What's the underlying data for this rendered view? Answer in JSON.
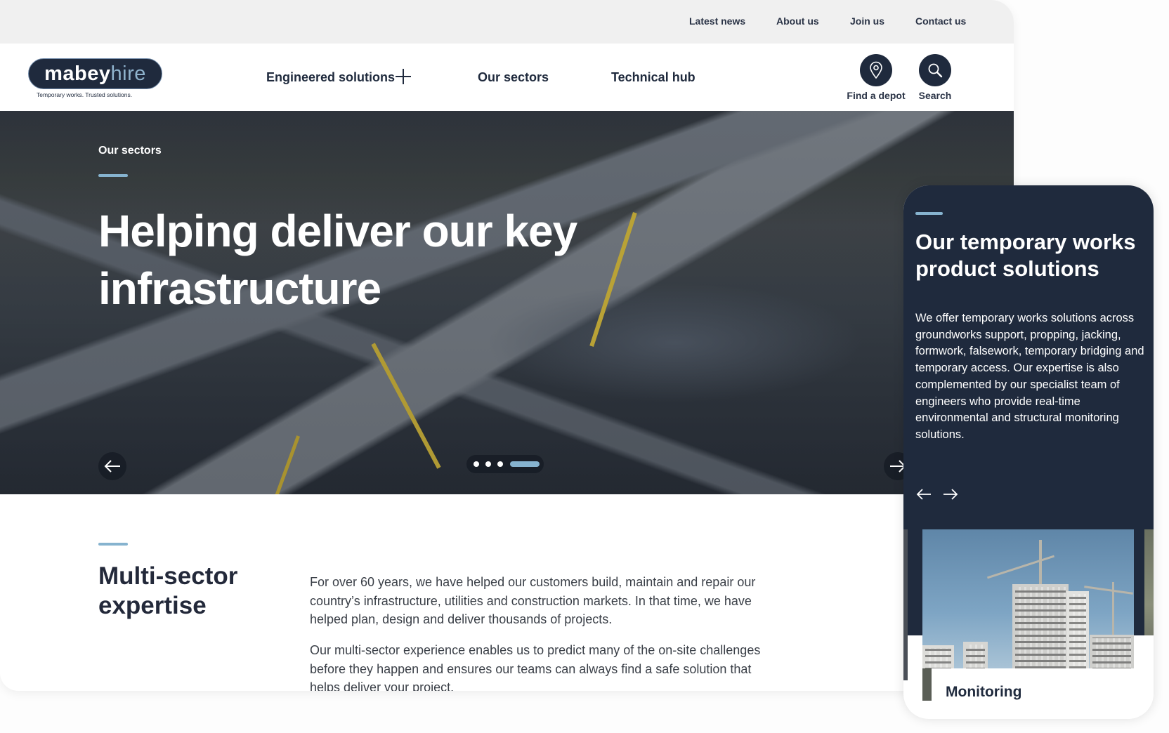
{
  "topbar": {
    "links": [
      "Latest news",
      "About us",
      "Join us",
      "Contact us"
    ]
  },
  "brand": {
    "name_part1": "mabey",
    "name_part2": "hire",
    "tagline": "Temporary works. Trusted solutions."
  },
  "nav": {
    "items": [
      "Engineered solutions",
      "Our sectors",
      "Technical hub"
    ],
    "find_depot_label": "Find a depot",
    "search_label": "Search",
    "find_depot_icon": "map-pin-icon",
    "search_icon": "search-icon",
    "expand_icon": "plus-icon"
  },
  "hero": {
    "eyebrow": "Our sectors",
    "title": "Helping deliver our key infrastructure",
    "slides_total": 4,
    "active_slide": 4,
    "prev_icon": "arrow-left-icon",
    "next_icon": "arrow-right-icon"
  },
  "section": {
    "title": "Multi-sector expertise",
    "paragraphs": [
      "For over 60 years, we have helped our customers build, maintain and repair our country’s infrastructure, utilities and construction markets. In that time, we have helped plan, design and deliver thousands of projects.",
      "Our multi-sector experience enables us to predict many of the on-site challenges before they happen and ensures our teams can always find a safe solution that helps deliver your project."
    ]
  },
  "mobile": {
    "title": "Our temporary works product solutions",
    "body": "We offer temporary works solutions across groundworks support, propping, jacking, formwork, falsework, temporary bridging and temporary access. Our expertise is also complemented by our specialist team of engineers who provide real-time environmental and structural monitoring solutions.",
    "card_label": "Monitoring",
    "prev_icon": "arrow-left-icon",
    "next_icon": "arrow-right-icon"
  },
  "colors": {
    "navy": "#1f2a3d",
    "accent": "#86b3cf",
    "topbar_bg": "#f0f0f0",
    "text": "#3a3f47"
  }
}
